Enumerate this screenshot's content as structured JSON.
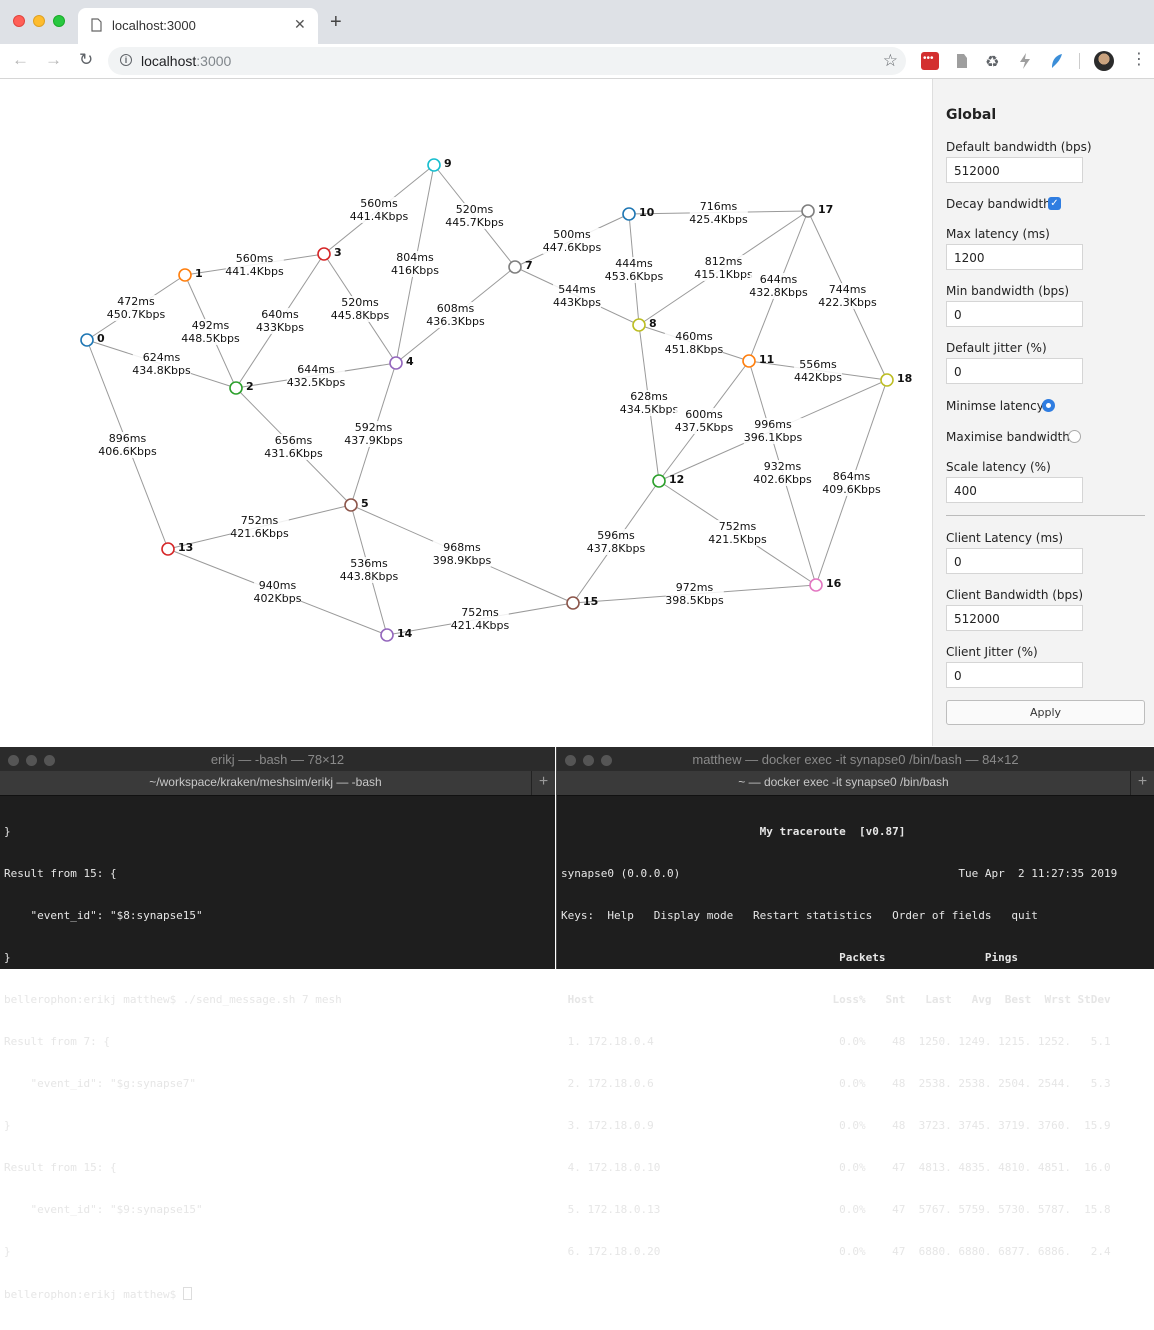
{
  "browser": {
    "tab_title": "localhost:3000",
    "url_host": "localhost",
    "url_port": ":3000"
  },
  "graph": {
    "nodes": [
      {
        "id": "0",
        "color": "#1f77b4"
      },
      {
        "id": "1",
        "color": "#ff7f0e"
      },
      {
        "id": "2",
        "color": "#2ca02c"
      },
      {
        "id": "3",
        "color": "#d62728"
      },
      {
        "id": "4",
        "color": "#9467bd"
      },
      {
        "id": "5",
        "color": "#8c564b"
      },
      {
        "id": "7",
        "color": "#7f7f7f"
      },
      {
        "id": "8",
        "color": "#bcbd22"
      },
      {
        "id": "9",
        "color": "#17becf"
      },
      {
        "id": "10",
        "color": "#1f77b4"
      },
      {
        "id": "11",
        "color": "#ff7f0e"
      },
      {
        "id": "12",
        "color": "#2ca02c"
      },
      {
        "id": "13",
        "color": "#d62728"
      },
      {
        "id": "14",
        "color": "#9467bd"
      },
      {
        "id": "15",
        "color": "#8c564b"
      },
      {
        "id": "16",
        "color": "#e377c2"
      },
      {
        "id": "17",
        "color": "#7f7f7f"
      },
      {
        "id": "18",
        "color": "#bcbd22"
      }
    ],
    "edges": [
      {
        "a": "0",
        "b": "1",
        "latency": "472ms",
        "bandwidth": "450.7Kbps"
      },
      {
        "a": "0",
        "b": "2",
        "latency": "624ms",
        "bandwidth": "434.8Kbps"
      },
      {
        "a": "0",
        "b": "13",
        "latency": "896ms",
        "bandwidth": "406.6Kbps"
      },
      {
        "a": "1",
        "b": "3",
        "latency": "560ms",
        "bandwidth": "441.4Kbps"
      },
      {
        "a": "1",
        "b": "2",
        "latency": "492ms",
        "bandwidth": "448.5Kbps"
      },
      {
        "a": "3",
        "b": "9",
        "latency": "560ms",
        "bandwidth": "441.4Kbps"
      },
      {
        "a": "3",
        "b": "2",
        "latency": "640ms",
        "bandwidth": "433Kbps"
      },
      {
        "a": "3",
        "b": "4",
        "latency": "520ms",
        "bandwidth": "445.8Kbps"
      },
      {
        "a": "9",
        "b": "7",
        "latency": "520ms",
        "bandwidth": "445.7Kbps"
      },
      {
        "a": "9",
        "b": "4",
        "latency": "804ms",
        "bandwidth": "416Kbps"
      },
      {
        "a": "2",
        "b": "4",
        "latency": "644ms",
        "bandwidth": "432.5Kbps"
      },
      {
        "a": "2",
        "b": "5",
        "latency": "656ms",
        "bandwidth": "431.6Kbps"
      },
      {
        "a": "4",
        "b": "7",
        "latency": "608ms",
        "bandwidth": "436.3Kbps"
      },
      {
        "a": "4",
        "b": "5",
        "latency": "592ms",
        "bandwidth": "437.9Kbps"
      },
      {
        "a": "7",
        "b": "10",
        "latency": "500ms",
        "bandwidth": "447.6Kbps"
      },
      {
        "a": "7",
        "b": "8",
        "latency": "544ms",
        "bandwidth": "443Kbps"
      },
      {
        "a": "10",
        "b": "17",
        "latency": "716ms",
        "bandwidth": "425.4Kbps"
      },
      {
        "a": "10",
        "b": "8",
        "latency": "444ms",
        "bandwidth": "453.6Kbps"
      },
      {
        "a": "17",
        "b": "8",
        "latency": "812ms",
        "bandwidth": "415.1Kbps"
      },
      {
        "a": "17",
        "b": "11",
        "latency": "644ms",
        "bandwidth": "432.8Kbps"
      },
      {
        "a": "17",
        "b": "18",
        "latency": "744ms",
        "bandwidth": "422.3Kbps"
      },
      {
        "a": "8",
        "b": "11",
        "latency": "460ms",
        "bandwidth": "451.8Kbps"
      },
      {
        "a": "8",
        "b": "12",
        "latency": "628ms",
        "bandwidth": "434.5Kbps"
      },
      {
        "a": "11",
        "b": "18",
        "latency": "556ms",
        "bandwidth": "442Kbps"
      },
      {
        "a": "11",
        "b": "12",
        "latency": "600ms",
        "bandwidth": "437.5Kbps"
      },
      {
        "a": "11",
        "b": "16",
        "latency": "932ms",
        "bandwidth": "402.6Kbps"
      },
      {
        "a": "18",
        "b": "12",
        "latency": "996ms",
        "bandwidth": "396.1Kbps"
      },
      {
        "a": "18",
        "b": "16",
        "latency": "864ms",
        "bandwidth": "409.6Kbps"
      },
      {
        "a": "12",
        "b": "15",
        "latency": "596ms",
        "bandwidth": "437.8Kbps"
      },
      {
        "a": "12",
        "b": "16",
        "latency": "752ms",
        "bandwidth": "421.5Kbps"
      },
      {
        "a": "5",
        "b": "13",
        "latency": "752ms",
        "bandwidth": "421.6Kbps"
      },
      {
        "a": "5",
        "b": "14",
        "latency": "536ms",
        "bandwidth": "443.8Kbps"
      },
      {
        "a": "5",
        "b": "15",
        "latency": "968ms",
        "bandwidth": "398.9Kbps"
      },
      {
        "a": "13",
        "b": "14",
        "latency": "940ms",
        "bandwidth": "402Kbps"
      },
      {
        "a": "14",
        "b": "15",
        "latency": "752ms",
        "bandwidth": "421.4Kbps"
      },
      {
        "a": "15",
        "b": "16",
        "latency": "972ms",
        "bandwidth": "398.5Kbps"
      }
    ]
  },
  "panel": {
    "title": "Global",
    "default_bandwidth_label": "Default bandwidth (bps)",
    "default_bandwidth_value": "512000",
    "decay_bandwidth_label": "Decay bandwidth",
    "decay_bandwidth_checked": true,
    "max_latency_label": "Max latency (ms)",
    "max_latency_value": "1200",
    "min_bandwidth_label": "Min bandwidth (bps)",
    "min_bandwidth_value": "0",
    "default_jitter_label": "Default jitter (%)",
    "default_jitter_value": "0",
    "minimise_latency_label": "Minimse latency",
    "maximise_bandwidth_label": "Maximise bandwidth",
    "scale_latency_label": "Scale latency (%)",
    "scale_latency_value": "400",
    "client_latency_label": "Client Latency (ms)",
    "client_latency_value": "0",
    "client_bandwidth_label": "Client Bandwidth (bps)",
    "client_bandwidth_value": "512000",
    "client_jitter_label": "Client Jitter (%)",
    "client_jitter_value": "0",
    "apply_label": "Apply"
  },
  "terminal_left": {
    "window_title": "erikj — -bash — 78×12",
    "tab_title": "~/workspace/kraken/meshsim/erikj — -bash",
    "lines": [
      "}",
      "Result from 15: {",
      "    \"event_id\": \"$8:synapse15\"",
      "}",
      "bellerophon:erikj matthew$ ./send_message.sh 7 mesh",
      "Result from 7: {",
      "    \"event_id\": \"$g:synapse7\"",
      "}",
      "Result from 15: {",
      "    \"event_id\": \"$9:synapse15\"",
      "}",
      "bellerophon:erikj matthew$ "
    ]
  },
  "terminal_right": {
    "window_title": "matthew — docker exec -it synapse0 /bin/bash — 84×12",
    "tab_title": "~ — docker exec -it synapse0 /bin/bash",
    "lines": [
      "                              My traceroute  [v0.87]",
      "synapse0 (0.0.0.0)                                          Tue Apr  2 11:27:35 2019",
      "Keys:  Help   Display mode   Restart statistics   Order of fields   quit",
      "                                          Packets               Pings",
      " Host                                    Loss%   Snt   Last   Avg  Best  Wrst StDev",
      " 1. 172.18.0.4                            0.0%    48  1250. 1249. 1215. 1252.   5.1",
      " 2. 172.18.0.6                            0.0%    48  2538. 2538. 2504. 2544.   5.3",
      " 3. 172.18.0.9                            0.0%    48  3723. 3745. 3719. 3760.  15.9",
      " 4. 172.18.0.10                           0.0%    47  4813. 4835. 4810. 4851.  16.0",
      " 5. 172.18.0.13                           0.0%    47  5767. 5759. 5730. 5787.  15.8",
      " 6. 172.18.0.20                           0.0%    47  6880. 6880. 6877. 6886.   2.4"
    ]
  }
}
